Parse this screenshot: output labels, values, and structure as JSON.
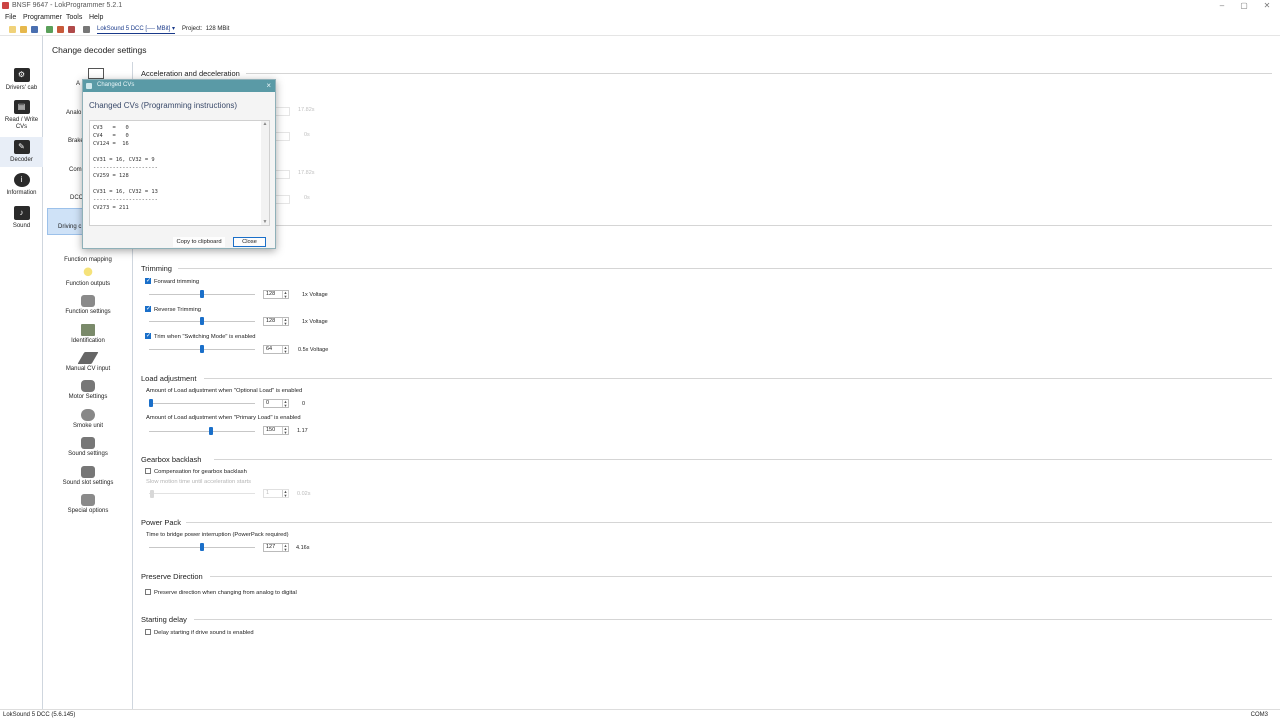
{
  "window": {
    "title": "BNSF 9647 - LokProgrammer 5.2.1",
    "controls": [
      "–",
      "▢",
      "✕"
    ]
  },
  "menu": [
    "File",
    "Programmer",
    "Tools",
    "Help"
  ],
  "toolbar": {
    "decoder_select": "LokSound 5 DCC [---- MBit]",
    "project_label": "Project:",
    "project_value": "128 MBit"
  },
  "leftbar": [
    {
      "label": "Drivers' cab",
      "icon": "drivers-cab-icon"
    },
    {
      "label": "Read / Write CVs",
      "icon": "read-write-icon"
    },
    {
      "label": "Decoder",
      "icon": "decoder-icon",
      "active": true
    },
    {
      "label": "Information",
      "icon": "information-icon"
    },
    {
      "label": "Sound",
      "icon": "sound-icon"
    }
  ],
  "panel_title": "Change decoder settings",
  "subnav": {
    "partials": [
      "A",
      "Analo",
      "Brake",
      "Comr",
      "DCC",
      "Driving c"
    ],
    "items": [
      {
        "label": "Function mapping"
      },
      {
        "label": "Function outputs"
      },
      {
        "label": "Function settings"
      },
      {
        "label": "Identification"
      },
      {
        "label": "Manual CV input"
      },
      {
        "label": "Motor Settings"
      },
      {
        "label": "Smoke unit"
      },
      {
        "label": "Sound settings"
      },
      {
        "label": "Sound slot settings"
      },
      {
        "label": "Special options"
      }
    ]
  },
  "accel": {
    "title": "Acceleration and deceleration",
    "ghost_units": [
      "17.82s",
      "0s",
      "17.82s",
      "0s"
    ]
  },
  "trimming": {
    "title": "Trimming",
    "rows": [
      {
        "label": "Forward trimming",
        "checked": true,
        "value": "128",
        "unit": "1x Voltage",
        "level": 0.5
      },
      {
        "label": "Reverse Trimming",
        "checked": true,
        "value": "128",
        "unit": "1x Voltage",
        "level": 0.5
      },
      {
        "label": "Trim when \"Switching Mode\" is enabled",
        "checked": true,
        "value": "64",
        "unit": "0.5x Voltage",
        "level": 0.5
      }
    ]
  },
  "load": {
    "title": "Load adjustment",
    "rows": [
      {
        "label": "Amount of Load adjustment when \"Optional Load\" is enabled",
        "value": "0",
        "unit": "0",
        "level": 0.0
      },
      {
        "label": "Amount of Load adjustment when \"Primary Load\" is enabled",
        "value": "150",
        "unit": "1.17",
        "level": 0.59
      }
    ]
  },
  "gearbox": {
    "title": "Gearbox backlash",
    "checkbox": "Compensation for gearbox backlash",
    "slow_label": "Slow motion time until acceleration starts",
    "value": "1",
    "unit": "0.02s"
  },
  "powerpack": {
    "title": "Power Pack",
    "label": "Time to bridge power interruption (PowerPack required)",
    "value": "127",
    "unit": "4.16s",
    "level": 0.5
  },
  "preserve": {
    "title": "Preserve Direction",
    "checkbox": "Preserve direction when changing from analog to digital"
  },
  "starting": {
    "title": "Starting delay",
    "checkbox": "Delay starting if drive sound is enabled"
  },
  "statusbar": {
    "left": "LokSound 5 DCC (5.6.145)",
    "right": "COM3"
  },
  "dialog": {
    "title": "Changed CVs",
    "heading": "Changed CVs (Programming instructions)",
    "lines": "CV3   =   0\nCV4   =   0\nCV124 =  16\n\nCV31 = 16, CV32 = 9\n--------------------\nCV259 = 128\n\nCV31 = 16, CV32 = 13\n--------------------\nCV273 = 211",
    "copy_button": "Copy to clipboard",
    "close_button": "Close"
  }
}
